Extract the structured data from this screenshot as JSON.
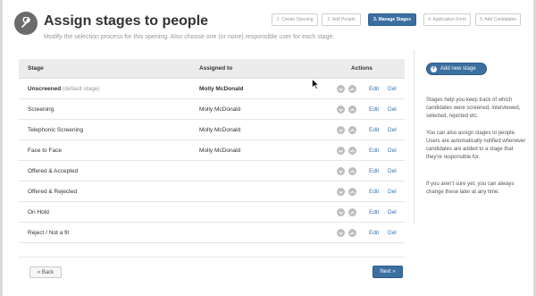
{
  "header": {
    "title": "Assign stages to people",
    "subtitle": "Modify the selection process for this opening. Also choose one (or none) responsible user for each stage."
  },
  "steps": [
    {
      "label": "1. Create Opening",
      "active": false
    },
    {
      "label": "2. Add People",
      "active": false
    },
    {
      "label": "3. Manage Stages",
      "active": true
    },
    {
      "label": "4. Application Form",
      "active": false
    },
    {
      "label": "5. Add Candidates",
      "active": false
    }
  ],
  "table": {
    "headers": {
      "stage": "Stage",
      "assigned": "Assigned to",
      "actions": "Actions"
    },
    "edit_label": "Edit",
    "del_label": "Del",
    "rows": [
      {
        "stage": "Unscreened",
        "note": "(default stage)",
        "assignee": "Molly McDonald"
      },
      {
        "stage": "Screening",
        "note": "",
        "assignee": "Molly McDonald"
      },
      {
        "stage": "Telephonic Screening",
        "note": "",
        "assignee": "Molly McDonald"
      },
      {
        "stage": "Face to Face",
        "note": "",
        "assignee": "Molly McDonald"
      },
      {
        "stage": "Offered & Accepted",
        "note": "",
        "assignee": ""
      },
      {
        "stage": "Offered & Rejected",
        "note": "",
        "assignee": ""
      },
      {
        "stage": "On Hold",
        "note": "",
        "assignee": ""
      },
      {
        "stage": "Reject / Not a fit",
        "note": "",
        "assignee": ""
      }
    ]
  },
  "sidebar": {
    "add_button": "Add new stage",
    "help": [
      "Stages help you keep track of which candidates were screened, interviewed, selected, rejected etc.",
      "You can also assign stages to people. Users are automatically notified whenever candidates are added to a stage that they're responsible for.",
      "If you aren't sure yet, you can always change these later at any time."
    ]
  },
  "footer": {
    "back_label": "« Back",
    "next_label": "Next »"
  },
  "colors": {
    "accent": "#3b6fa0",
    "link": "#3a74b3"
  }
}
